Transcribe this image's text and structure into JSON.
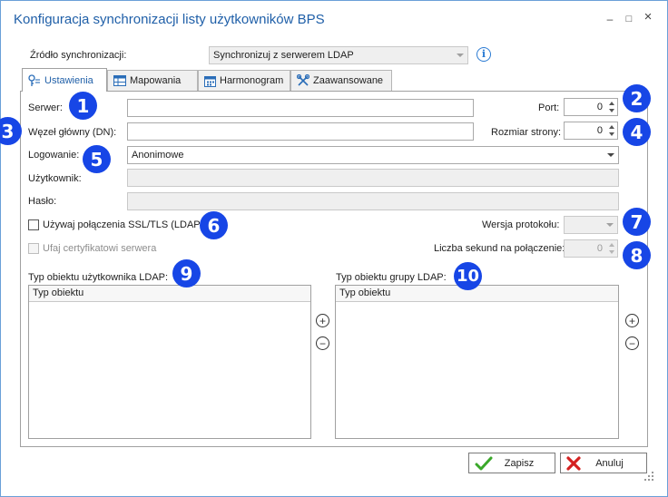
{
  "window": {
    "title": "Konfiguracja synchronizacji listy użytkowników BPS",
    "minimize_glyph": "–",
    "maximize_glyph": "□",
    "close_glyph": "×"
  },
  "source": {
    "label": "Źródło synchronizacji:",
    "value": "Synchronizuj z serwerem LDAP",
    "info_glyph": "i"
  },
  "tabs": [
    {
      "label": "Ustawienia",
      "icon": "key-list-icon",
      "active": true
    },
    {
      "label": "Mapowania",
      "icon": "table-icon",
      "active": false
    },
    {
      "label": "Harmonogram",
      "icon": "calendar-icon",
      "active": false
    },
    {
      "label": "Zaawansowane",
      "icon": "tools-icon",
      "active": false
    }
  ],
  "settings": {
    "server_label": "Serwer:",
    "server_value": "",
    "port_label": "Port:",
    "port_value": "0",
    "base_dn_label": "Węzeł główny (DN):",
    "base_dn_value": "",
    "page_size_label": "Rozmiar strony:",
    "page_size_value": "0",
    "login_label": "Logowanie:",
    "login_value": "Anonimowe",
    "user_label": "Użytkownik:",
    "user_value": "",
    "password_label": "Hasło:",
    "password_value": "",
    "ssl_label": "Używaj połączenia SSL/TLS (LDAPS)",
    "ssl_checked": false,
    "protocol_label": "Wersja protokołu:",
    "protocol_value": "",
    "trust_cert_label": "Ufaj certyfikatowi serwera",
    "timeout_label": "Liczba sekund na połączenie:",
    "timeout_value": "0"
  },
  "user_object": {
    "label": "Typ obiektu użytkownika LDAP:",
    "column": "Typ obiektu",
    "rows": []
  },
  "group_object": {
    "label": "Typ obiektu grupy LDAP:",
    "column": "Typ obiektu",
    "rows": []
  },
  "list_buttons": {
    "add_glyph": "+",
    "remove_glyph": "−"
  },
  "buttons": {
    "save": "Zapisz",
    "cancel": "Anuluj"
  },
  "badges": [
    "1",
    "2",
    "3",
    "4",
    "5",
    "6",
    "7",
    "8",
    "9",
    "10"
  ],
  "colors": {
    "title": "#1f5fa8",
    "badge": "#1746e6",
    "accent_border": "#6aa0d8"
  }
}
